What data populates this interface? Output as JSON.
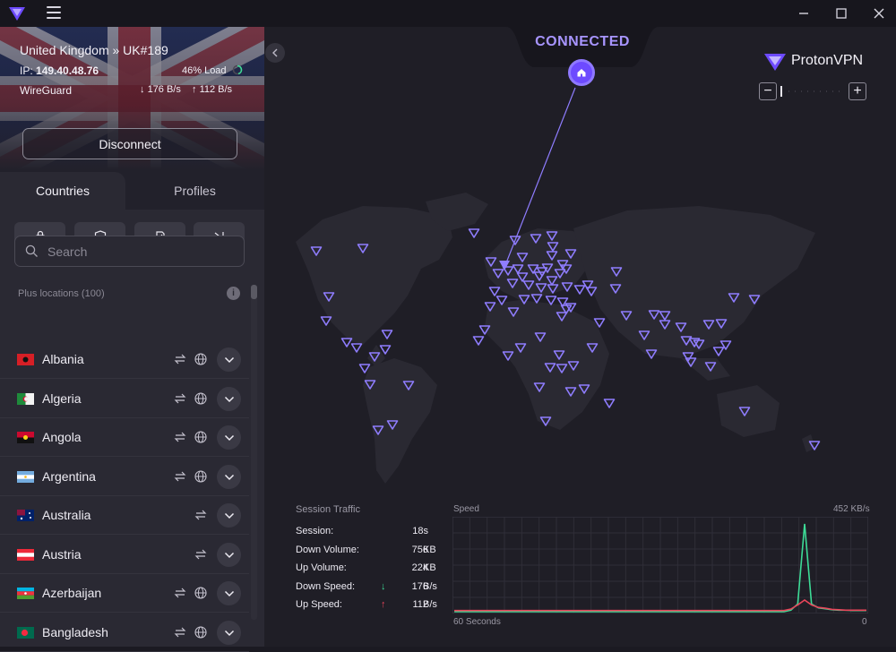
{
  "window": {
    "minimize": "─",
    "maximize": "☐",
    "close": "✕"
  },
  "connection": {
    "location": "United Kingdom » UK#189",
    "ip_label": "IP:",
    "ip": "149.40.48.76",
    "load": "46% Load",
    "load_fraction": 0.46,
    "protocol": "WireGuard",
    "down": "176 B/s",
    "up": "112 B/s",
    "disconnect_label": "Disconnect"
  },
  "tabs": {
    "countries": "Countries",
    "profiles": "Profiles"
  },
  "filters": [
    "lock-icon",
    "shield-icon",
    "p2p-icon",
    "tor-icon"
  ],
  "search": {
    "placeholder": "Search"
  },
  "list": {
    "section_label": "Plus locations (100)",
    "info_icon": "i",
    "countries": [
      {
        "name": "Albania",
        "flag": "albania",
        "globe": true
      },
      {
        "name": "Algeria",
        "flag": "algeria",
        "globe": true
      },
      {
        "name": "Angola",
        "flag": "angola",
        "globe": true
      },
      {
        "name": "Argentina",
        "flag": "argentina",
        "globe": true
      },
      {
        "name": "Australia",
        "flag": "australia",
        "globe": false
      },
      {
        "name": "Austria",
        "flag": "austria",
        "globe": false
      },
      {
        "name": "Azerbaijan",
        "flag": "azerbaijan",
        "globe": true
      },
      {
        "name": "Bangladesh",
        "flag": "bangladesh",
        "globe": true
      }
    ]
  },
  "map": {
    "status": "CONNECTED",
    "brand": "ProtonVPN",
    "zoom_out": "−",
    "zoom_in": "+",
    "accent": "#6d4aff",
    "marker_color": "#8f7dff"
  },
  "session_traffic": {
    "title": "Session Traffic",
    "rows": [
      {
        "label": "Session:",
        "value": "18s",
        "unit": ""
      },
      {
        "label": "Down Volume:",
        "value": "756",
        "unit": "KB"
      },
      {
        "label": "Up Volume:",
        "value": "224",
        "unit": "KB"
      },
      {
        "label": "Down Speed:",
        "value": "176",
        "unit": "B/s"
      },
      {
        "label": "Up Speed:",
        "value": "112",
        "unit": "B/s"
      }
    ]
  },
  "chart_data": {
    "type": "line",
    "title": "Speed",
    "ymax_label": "452 KB/s",
    "xlabel_left": "60 Seconds",
    "xlabel_right": "0",
    "ylim": [
      0,
      452
    ],
    "grid": true,
    "series": [
      {
        "color": "#3ddc97",
        "values": [
          0,
          0,
          0,
          0,
          0,
          0,
          0,
          0,
          0,
          0,
          0,
          0,
          0,
          0,
          0,
          0,
          0,
          0,
          0,
          0,
          0,
          0,
          0,
          0,
          0,
          0,
          0,
          0,
          0,
          0,
          0,
          0,
          0,
          0,
          0,
          0,
          0,
          0,
          0,
          0,
          0,
          0,
          0,
          0,
          0,
          0,
          0,
          0,
          0,
          8,
          40,
          452,
          40,
          20,
          15,
          10,
          8,
          8,
          6,
          6,
          6
        ]
      },
      {
        "color": "#e8455a",
        "values": [
          6,
          6,
          6,
          6,
          6,
          6,
          6,
          6,
          6,
          6,
          6,
          6,
          6,
          6,
          6,
          6,
          6,
          6,
          6,
          6,
          6,
          6,
          6,
          6,
          6,
          6,
          6,
          6,
          6,
          6,
          6,
          6,
          6,
          6,
          6,
          6,
          6,
          6,
          6,
          6,
          6,
          6,
          6,
          6,
          6,
          6,
          6,
          6,
          6,
          14,
          35,
          60,
          35,
          22,
          18,
          12,
          10,
          8,
          8,
          8,
          8
        ]
      }
    ]
  }
}
